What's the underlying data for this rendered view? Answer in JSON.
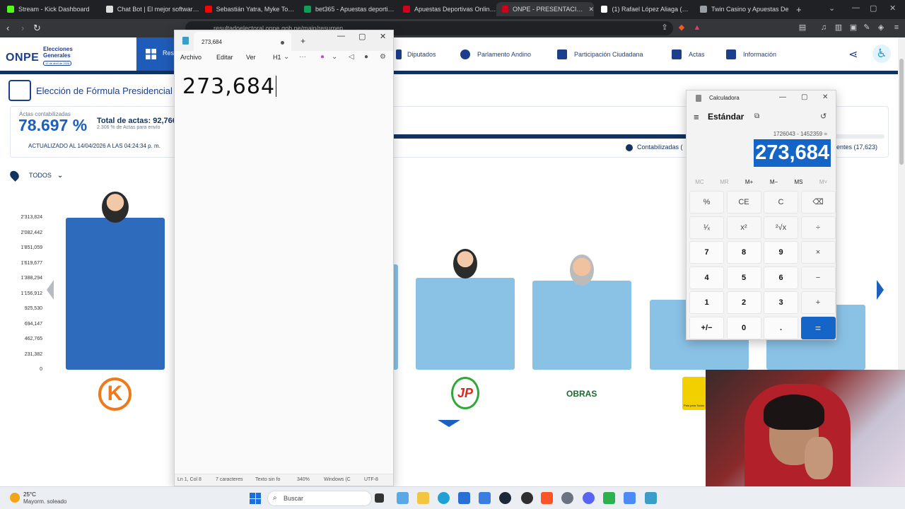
{
  "browser": {
    "tabs": [
      {
        "label": "Stream - Kick Dashboard",
        "color": "#53fc18"
      },
      {
        "label": "Chat Bot | El mejor software p",
        "color": "#ffffff"
      },
      {
        "label": "Sebastián Yatra, Myke Towers",
        "color": "#ff0000"
      },
      {
        "label": "bet365 - Apuestas deportivas",
        "color": "#0f9d58"
      },
      {
        "label": "Apuestas Deportivas Online |",
        "color": "#d0021b"
      },
      {
        "label": "ONPE - PRESENTACIÓN D",
        "color": "#d0021b",
        "active": true
      },
      {
        "label": "(1) Rafael López Aliaga (@rlop",
        "color": "#ffffff"
      },
      {
        "label": "Twin Casino y Apuestas De",
        "color": "#9aa0a6"
      }
    ],
    "url": "resultadoelectoral.onpe.gob.pe/main/resumen"
  },
  "onpe": {
    "logo_text": "ONPE",
    "logo_subtitle_line1": "Elecciones",
    "logo_subtitle_line2": "Generales",
    "logo_date": "12 de abril de 2026",
    "nav_active": "Res",
    "nav_items": [
      "Diputados",
      "Parlamento Andino",
      "Participación Ciudadana",
      "Actas",
      "Información"
    ],
    "section_title": "Elección de Fórmula Presidencial",
    "actas_label": "Actas contabilizadas",
    "actas_pct": "78.697 %",
    "actas_progress": 0.787,
    "total_actas": "Total de actas: 92,766",
    "pct_envio": "2.306 % de Actas para envío",
    "updated": "ACTUALIZADO AL 14/04/2026 A LAS 04:24:34 p. m.",
    "legend_contabilizadas": "Contabilizadas (",
    "legend_pendientes": "ientes (17,623)",
    "filter_label": "TODOS",
    "party_obras": "OBRAS",
    "party_k": "K",
    "party_jp": "JP",
    "party_yellow_caption": "País para Todos"
  },
  "chart_data": {
    "type": "bar",
    "ylim": [
      0,
      2313824
    ],
    "yticks": [
      "2'313,824",
      "2'082,442",
      "1'851,059",
      "1'619,677",
      "1'388,294",
      "1'156,912",
      "925,530",
      "694,147",
      "462,765",
      "231,382",
      "0"
    ],
    "series": [
      {
        "values": [
          2313824,
          null,
          null,
          1394000,
          1353000,
          1065000,
          992000
        ]
      }
    ]
  },
  "notepad": {
    "tab_title": "273,684",
    "menu": [
      "Archivo",
      "Editar",
      "Ver",
      "H1"
    ],
    "content": "273,684",
    "status": {
      "position": "Ln 1, Col 8",
      "chars": "7 caracteres",
      "format": "Texto sin fo",
      "zoom": "340%",
      "line_ending": "Windows (C",
      "encoding": "UTF-8"
    }
  },
  "calculator": {
    "title": "Calculadora",
    "mode": "Estándar",
    "expression": "1726043 - 1452359 =",
    "display": "273,684",
    "memory": [
      "MC",
      "MR",
      "M+",
      "M−",
      "MS",
      "M˅"
    ],
    "keys": [
      [
        "%",
        "CE",
        "C",
        "⌫"
      ],
      [
        "¹⁄ₓ",
        "x²",
        "²√x",
        "÷"
      ],
      [
        "7",
        "8",
        "9",
        "×"
      ],
      [
        "4",
        "5",
        "6",
        "−"
      ],
      [
        "1",
        "2",
        "3",
        "+"
      ],
      [
        "+/−",
        "0",
        ".",
        "="
      ]
    ]
  },
  "taskbar": {
    "temp": "25°C",
    "weather": "Mayorm. soleado",
    "search_placeholder": "Buscar"
  }
}
